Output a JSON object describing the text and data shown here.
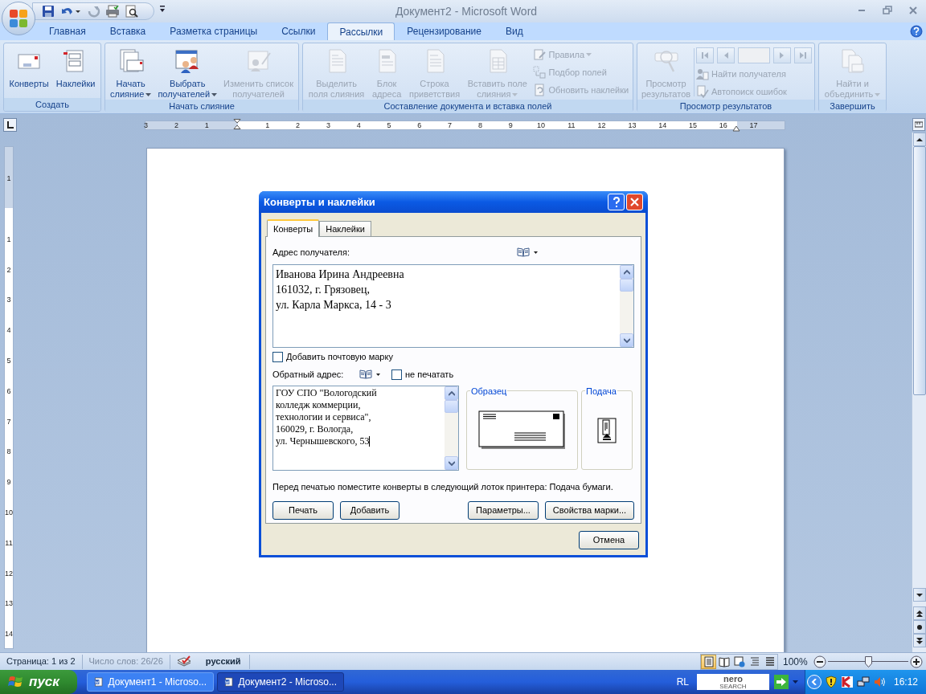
{
  "window": {
    "title": "Документ2 - Microsoft Word"
  },
  "tabs": [
    {
      "label": "Главная",
      "selected": false
    },
    {
      "label": "Вставка",
      "selected": false
    },
    {
      "label": "Разметка страницы",
      "selected": false
    },
    {
      "label": "Ссылки",
      "selected": false
    },
    {
      "label": "Рассылки",
      "selected": true
    },
    {
      "label": "Рецензирование",
      "selected": false
    },
    {
      "label": "Вид",
      "selected": false
    }
  ],
  "ribbon": {
    "groups": [
      {
        "title": "Создать",
        "items": [
          {
            "kind": "large",
            "lines": [
              "Конверты"
            ],
            "disabled": false,
            "dropdown": false
          },
          {
            "kind": "large",
            "lines": [
              "Наклейки"
            ],
            "disabled": false,
            "dropdown": false
          }
        ]
      },
      {
        "title": "Начать слияние",
        "items": [
          {
            "kind": "large",
            "lines": [
              "Начать",
              "слияние"
            ],
            "disabled": false,
            "dropdown": true
          },
          {
            "kind": "large",
            "lines": [
              "Выбрать",
              "получателей"
            ],
            "disabled": false,
            "dropdown": true
          },
          {
            "kind": "large",
            "lines": [
              "Изменить список",
              "получателей"
            ],
            "disabled": true,
            "dropdown": false
          }
        ]
      },
      {
        "title": "Составление документа и вставка полей",
        "items": [
          {
            "kind": "large",
            "lines": [
              "Выделить",
              "поля слияния"
            ],
            "disabled": true,
            "dropdown": false
          },
          {
            "kind": "large",
            "lines": [
              "Блок",
              "адреса"
            ],
            "disabled": true,
            "dropdown": false
          },
          {
            "kind": "large",
            "lines": [
              "Строка",
              "приветствия"
            ],
            "disabled": true,
            "dropdown": false
          },
          {
            "kind": "large",
            "lines": [
              "Вставить поле",
              "слияния"
            ],
            "disabled": true,
            "dropdown": true
          },
          {
            "kind": "small",
            "lines": [
              "Правила"
            ],
            "disabled": true,
            "dropdown": true
          },
          {
            "kind": "small",
            "lines": [
              "Подбор полей"
            ],
            "disabled": true,
            "dropdown": false
          },
          {
            "kind": "small",
            "lines": [
              "Обновить наклейки"
            ],
            "disabled": true,
            "dropdown": false
          }
        ]
      },
      {
        "title": "Просмотр результатов",
        "items": [
          {
            "kind": "large",
            "lines": [
              "Просмотр",
              "результатов"
            ],
            "disabled": true,
            "dropdown": false
          },
          {
            "kind": "nav",
            "disabled": true
          },
          {
            "kind": "small",
            "lines": [
              "Найти получателя"
            ],
            "disabled": true,
            "dropdown": false
          },
          {
            "kind": "small",
            "lines": [
              "Автопоиск ошибок"
            ],
            "disabled": true,
            "dropdown": false
          }
        ]
      },
      {
        "title": "Завершить",
        "items": [
          {
            "kind": "large",
            "lines": [
              "Найти и",
              "объединить"
            ],
            "disabled": true,
            "dropdown": true
          }
        ]
      }
    ]
  },
  "ruler": {
    "left_marks": [
      "3",
      "2",
      "1"
    ],
    "right_marks": [
      "1",
      "2",
      "3",
      "4",
      "5",
      "6",
      "7",
      "8",
      "9",
      "10",
      "11",
      "12",
      "13",
      "14",
      "15",
      "16",
      "17"
    ],
    "vertical_top_marks": [
      "1"
    ],
    "vertical_marks": [
      "1",
      "2",
      "3",
      "4",
      "5",
      "6",
      "7",
      "8",
      "9",
      "10",
      "11",
      "12",
      "13",
      "14"
    ]
  },
  "dialog": {
    "title": "Конверты и наклейки",
    "tabs": [
      {
        "label": "Конверты",
        "selected": true
      },
      {
        "label": "Наклейки",
        "selected": false
      }
    ],
    "recipient_label": "Адрес получателя:",
    "recipient_lines": [
      "Иванова Ирина Андреевна",
      "161032, г. Грязовец,",
      "ул. Карла Маркса, 14 - 3"
    ],
    "stamp_checkbox": {
      "label": "Добавить почтовую марку",
      "checked": false
    },
    "return_label": "Обратный адрес:",
    "omit_checkbox": {
      "label": "не печатать",
      "checked": false
    },
    "return_lines": [
      "ГОУ СПО \"Вологодский",
      "колледж коммерции,",
      "технологии и сервиса\",",
      "160029, г. Вологда,",
      "ул. Чернышевского, 53"
    ],
    "preview_title": "Образец",
    "feed_title": "Подача",
    "note": "Перед печатью поместите конверты в следующий лоток принтера: Подача бумаги.",
    "left_buttons": [
      "Печать",
      "Добавить"
    ],
    "right_buttons": [
      "Параметры...",
      "Свойства марки..."
    ],
    "cancel": "Отмена"
  },
  "status_bar": {
    "page": "Страница: 1 из 2",
    "words": "Число слов: 26/26",
    "language": "русский",
    "views": [
      {
        "selected": true
      },
      {
        "selected": false
      },
      {
        "selected": false
      },
      {
        "selected": false
      },
      {
        "selected": false
      }
    ],
    "zoom": {
      "label": "100%",
      "level": 0.5
    }
  },
  "taskbar": {
    "start": "пуск",
    "tasks": [
      {
        "label": "Документ1 - Microso...",
        "selected": false
      },
      {
        "label": "Документ2 - Microso...",
        "selected": true
      }
    ],
    "lang": "RL",
    "search_logo_top": "nero",
    "search_logo_bottom": "SEARCH",
    "clock": "16:12"
  }
}
